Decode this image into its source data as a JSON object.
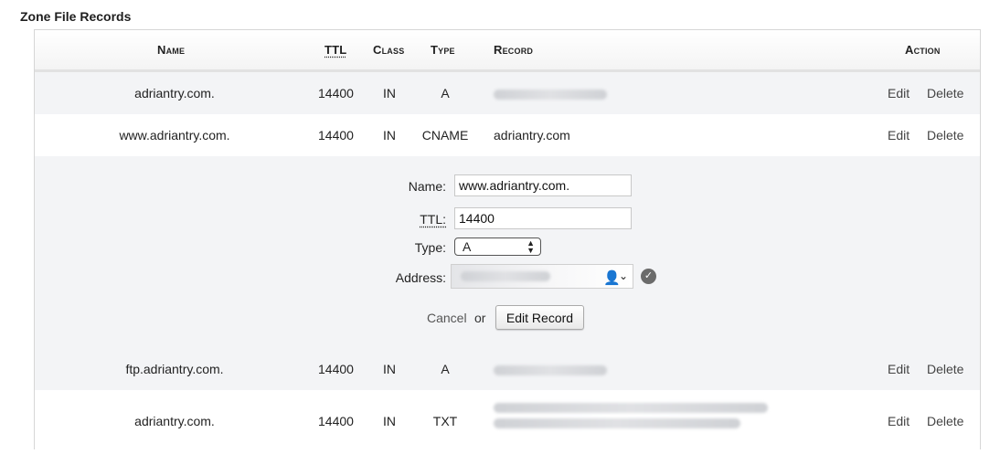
{
  "page": {
    "title": "Zone File Records"
  },
  "columns": {
    "name": "Name",
    "ttl": "TTL",
    "class": "Class",
    "type": "Type",
    "record": "Record",
    "action": "Action"
  },
  "actions": {
    "edit": "Edit",
    "delete": "Delete"
  },
  "rows": [
    {
      "name": "adriantry.com.",
      "ttl": "14400",
      "class": "IN",
      "type": "A",
      "record": "",
      "record_obscured": true
    },
    {
      "name": "www.adriantry.com.",
      "ttl": "14400",
      "class": "IN",
      "type": "CNAME",
      "record": "adriantry.com",
      "record_obscured": false
    },
    {
      "name": "ftp.adriantry.com.",
      "ttl": "14400",
      "class": "IN",
      "type": "A",
      "record": "",
      "record_obscured": true
    },
    {
      "name": "adriantry.com.",
      "ttl": "14400",
      "class": "IN",
      "type": "TXT",
      "record": "",
      "record_obscured": true
    }
  ],
  "edit_form": {
    "name_label": "Name:",
    "name_value": "www.adriantry.com.",
    "ttl_label": "TTL:",
    "ttl_value": "14400",
    "type_label": "Type:",
    "type_value": "A",
    "address_label": "Address:",
    "address_value": "",
    "cancel_label": "Cancel",
    "or_label": "or",
    "submit_label": "Edit Record"
  },
  "icons": {
    "address_user": "user-icon",
    "address_dropdown": "chevron-down-icon",
    "address_valid": "check-circle-icon"
  }
}
